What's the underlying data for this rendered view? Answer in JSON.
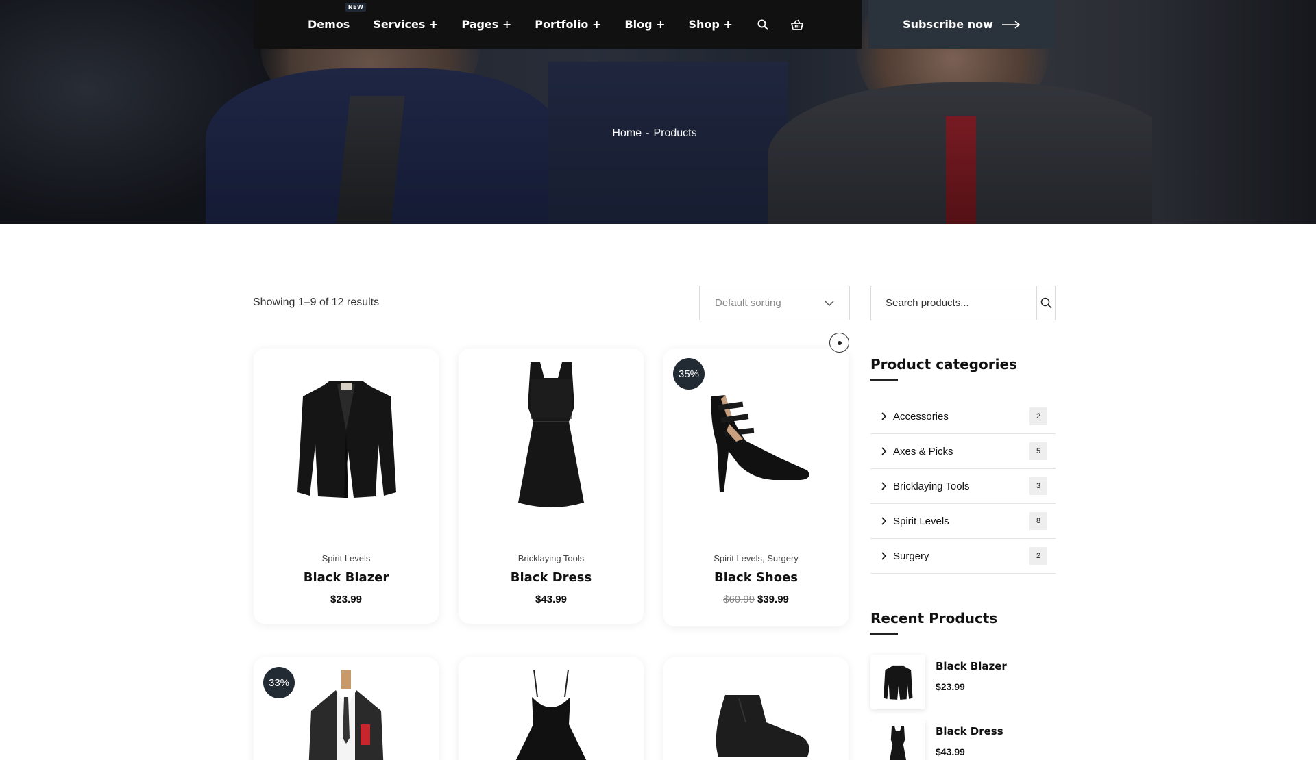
{
  "nav": {
    "items": [
      {
        "label": "Demos",
        "badge": "NEW"
      },
      {
        "label": "Services +"
      },
      {
        "label": "Pages +"
      },
      {
        "label": "Portfolio +"
      },
      {
        "label": "Blog +"
      },
      {
        "label": "Shop +"
      }
    ],
    "subscribe_label": "Subscribe now",
    "search_icon": "search-icon",
    "cart_icon": "basket-icon"
  },
  "breadcrumb": {
    "home": "Home",
    "separator": "-",
    "current": "Products"
  },
  "toolbar": {
    "results": "Showing 1–9 of 12 results",
    "sorting": "Default sorting"
  },
  "products": [
    {
      "category": "Spirit Levels",
      "name": "Black Blazer",
      "price": "$23.99",
      "old_price": "",
      "sale": ""
    },
    {
      "category": "Bricklaying Tools",
      "name": "Black Dress",
      "price": "$43.99",
      "old_price": "",
      "sale": ""
    },
    {
      "category": "Spirit Levels, Surgery",
      "name": "Black Shoes",
      "price": "$39.99",
      "old_price": "$60.99",
      "sale": "35%"
    },
    {
      "sale": "33%"
    },
    {
      "sale": ""
    },
    {
      "sale": ""
    }
  ],
  "sidebar": {
    "search_placeholder": "Search products...",
    "categories_title": "Product categories",
    "categories": [
      {
        "label": "Accessories",
        "count": "2"
      },
      {
        "label": "Axes & Picks",
        "count": "5"
      },
      {
        "label": "Bricklaying Tools",
        "count": "3"
      },
      {
        "label": "Spirit Levels",
        "count": "8"
      },
      {
        "label": "Surgery",
        "count": "2"
      }
    ],
    "recent_title": "Recent Products",
    "recent": [
      {
        "name": "Black Blazer",
        "price": "$23.99"
      },
      {
        "name": "Black Dress",
        "price": "$43.99"
      }
    ]
  },
  "colors": {
    "nav_bg": "#111111",
    "subscribe_bg": "#2a323b",
    "badge_bg": "#222a33"
  }
}
